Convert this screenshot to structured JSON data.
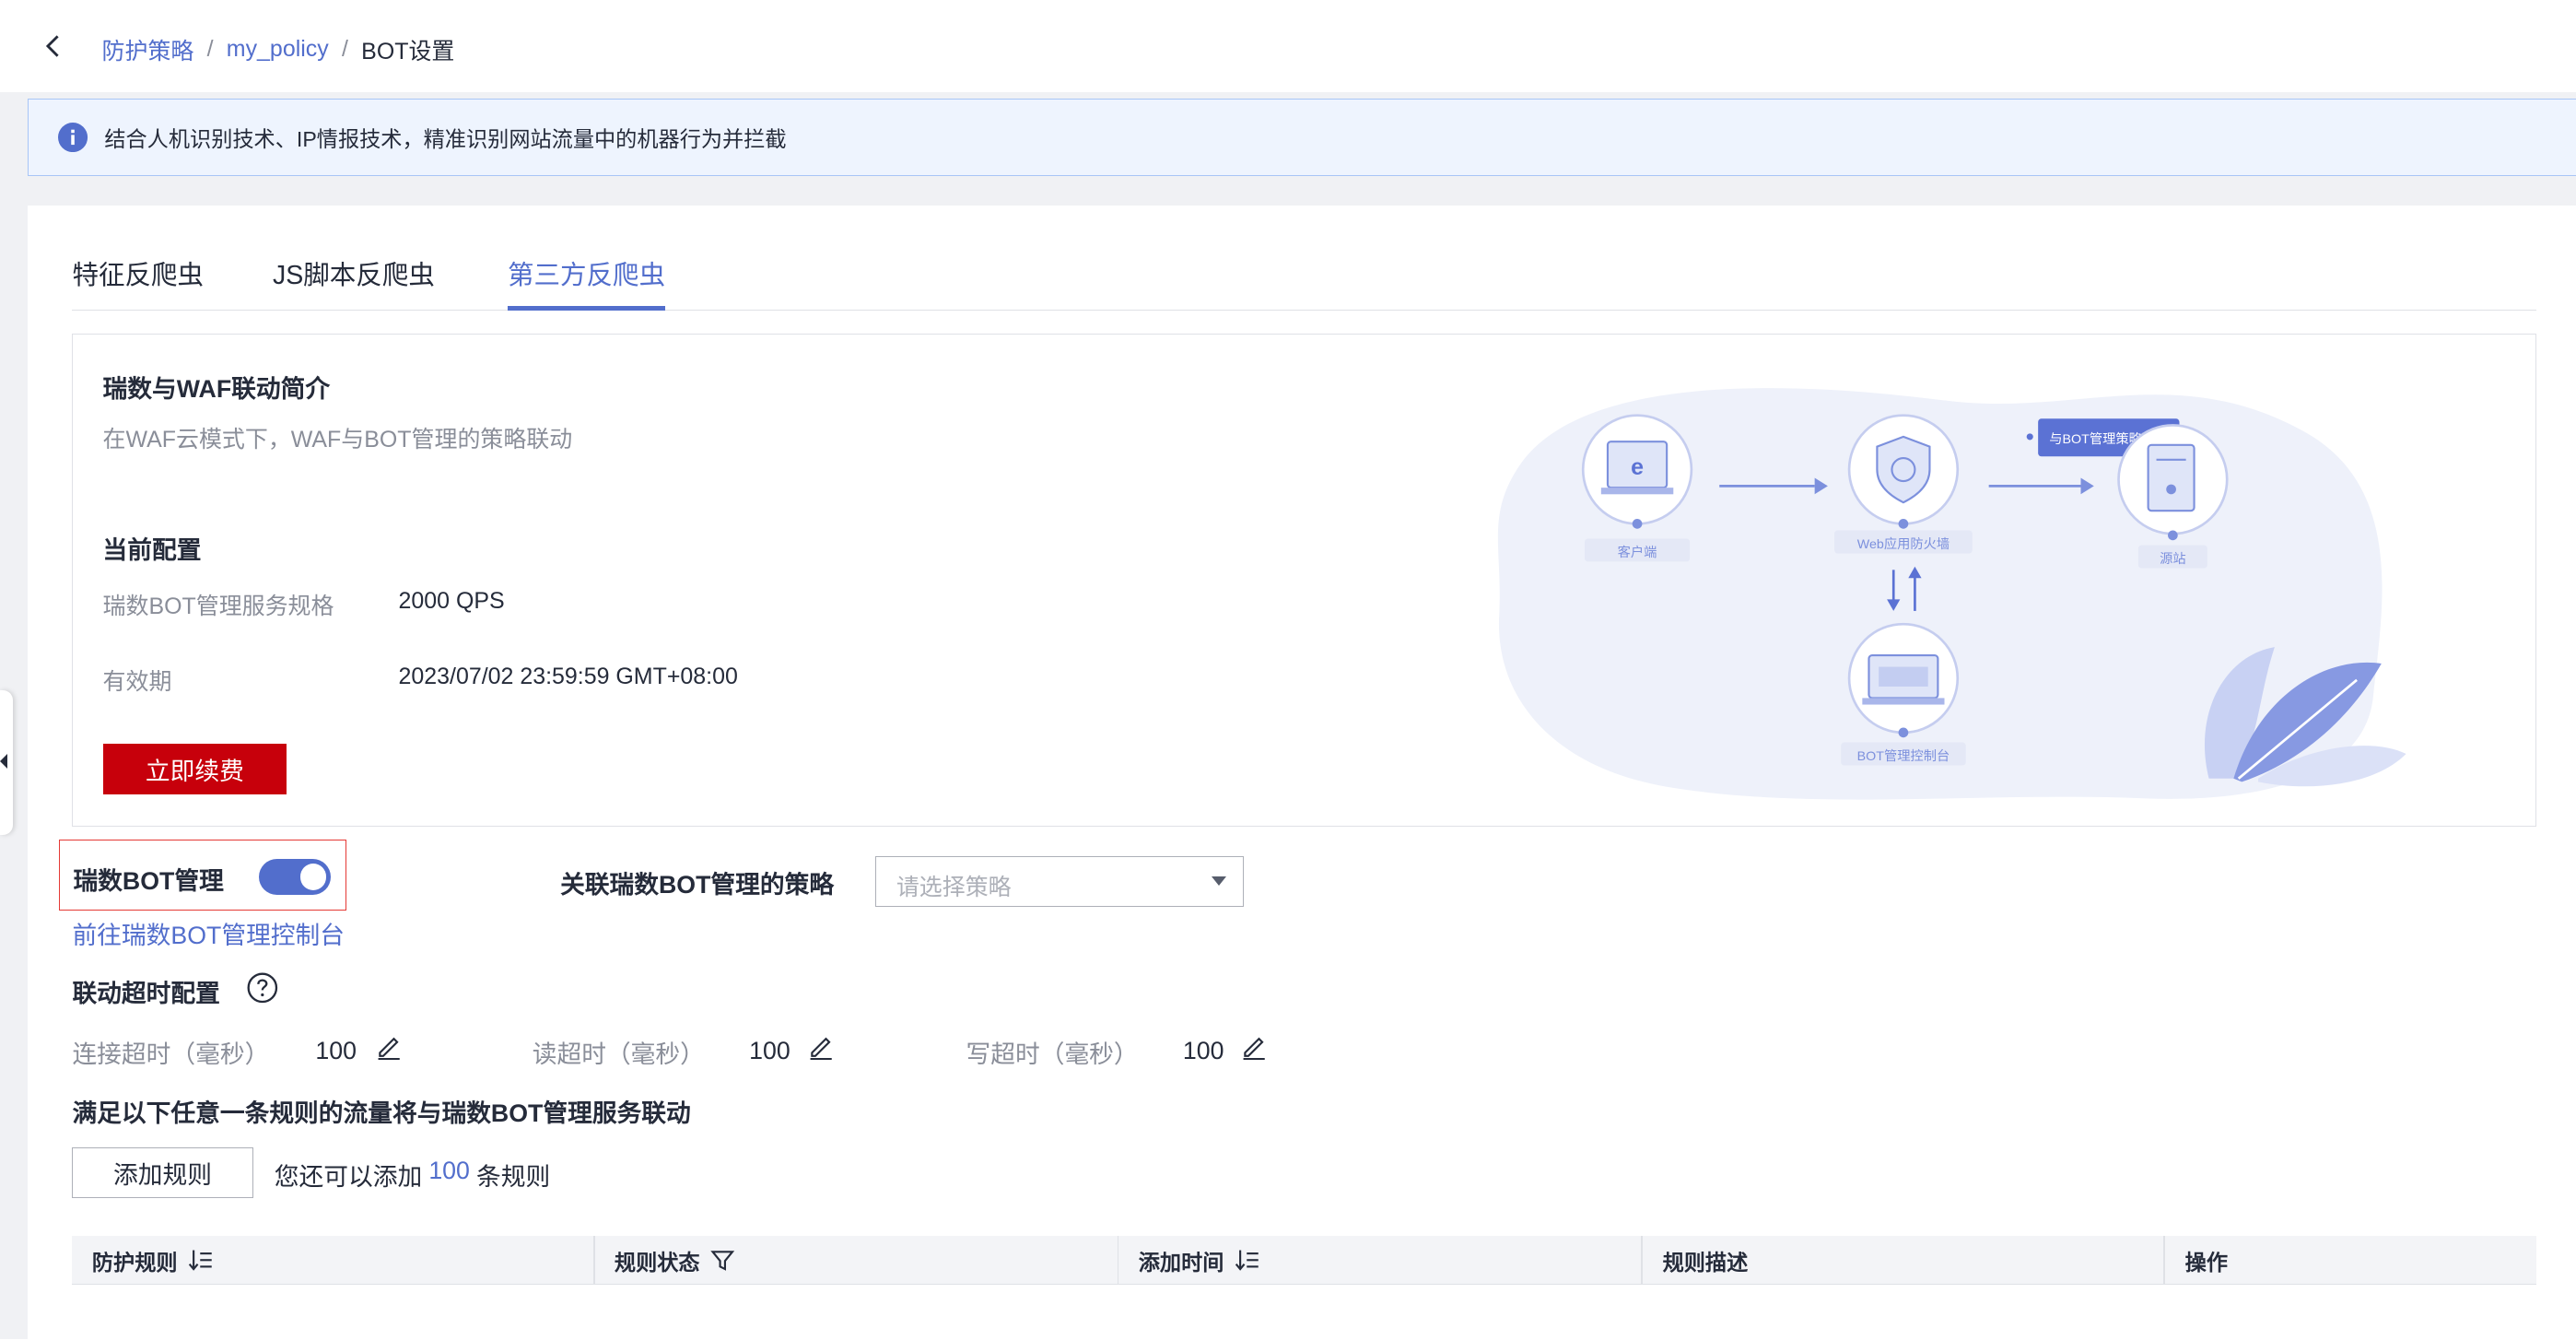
{
  "breadcrumb": {
    "items": [
      "防护策略",
      "my_policy"
    ],
    "separator": "/",
    "current": "BOT设置"
  },
  "notice": {
    "text": "结合人机识别技术、IP情报技术，精准识别网站流量中的机器行为并拦截"
  },
  "tabs": [
    {
      "label": "特征反爬虫",
      "active": false
    },
    {
      "label": "JS脚本反爬虫",
      "active": false
    },
    {
      "label": "第三方反爬虫",
      "active": true
    }
  ],
  "intro": {
    "title": "瑞数与WAF联动简介",
    "subtitle": "在WAF云模式下，WAF与BOT管理的策略联动",
    "config_title": "当前配置",
    "spec_label": "瑞数BOT管理服务规格",
    "spec_value": "2000 QPS",
    "validity_label": "有效期",
    "validity_value": "2023/07/02 23:59:59 GMT+08:00",
    "renew_button": "立即续费"
  },
  "diagram": {
    "client_label": "客户端",
    "waf_label": "Web应用防火墙",
    "origin_label": "源站",
    "console_label": "BOT管理控制台",
    "linkage_tag": "与BOT管理策略联动"
  },
  "bot": {
    "label": "瑞数BOT管理",
    "enabled": true,
    "assoc_label": "关联瑞数BOT管理的策略",
    "select_placeholder": "请选择策略",
    "console_link": "前往瑞数BOT管理控制台"
  },
  "timeout": {
    "title": "联动超时配置",
    "connect_label": "连接超时（毫秒）",
    "connect_value": "100",
    "read_label": "读超时（毫秒）",
    "read_value": "100",
    "write_label": "写超时（毫秒）",
    "write_value": "100"
  },
  "rules": {
    "title": "满足以下任意一条规则的流量将与瑞数BOT管理服务联动",
    "add_button": "添加规则",
    "quota_prefix": "您还可以添加",
    "quota_count": "100",
    "quota_suffix": "条规则"
  },
  "table": {
    "columns": [
      "防护规则",
      "规则状态",
      "添加时间",
      "规则描述",
      "操作"
    ]
  },
  "colors": {
    "accent": "#526ecc",
    "danger": "#c7000b",
    "highlight_border": "#e53935"
  }
}
